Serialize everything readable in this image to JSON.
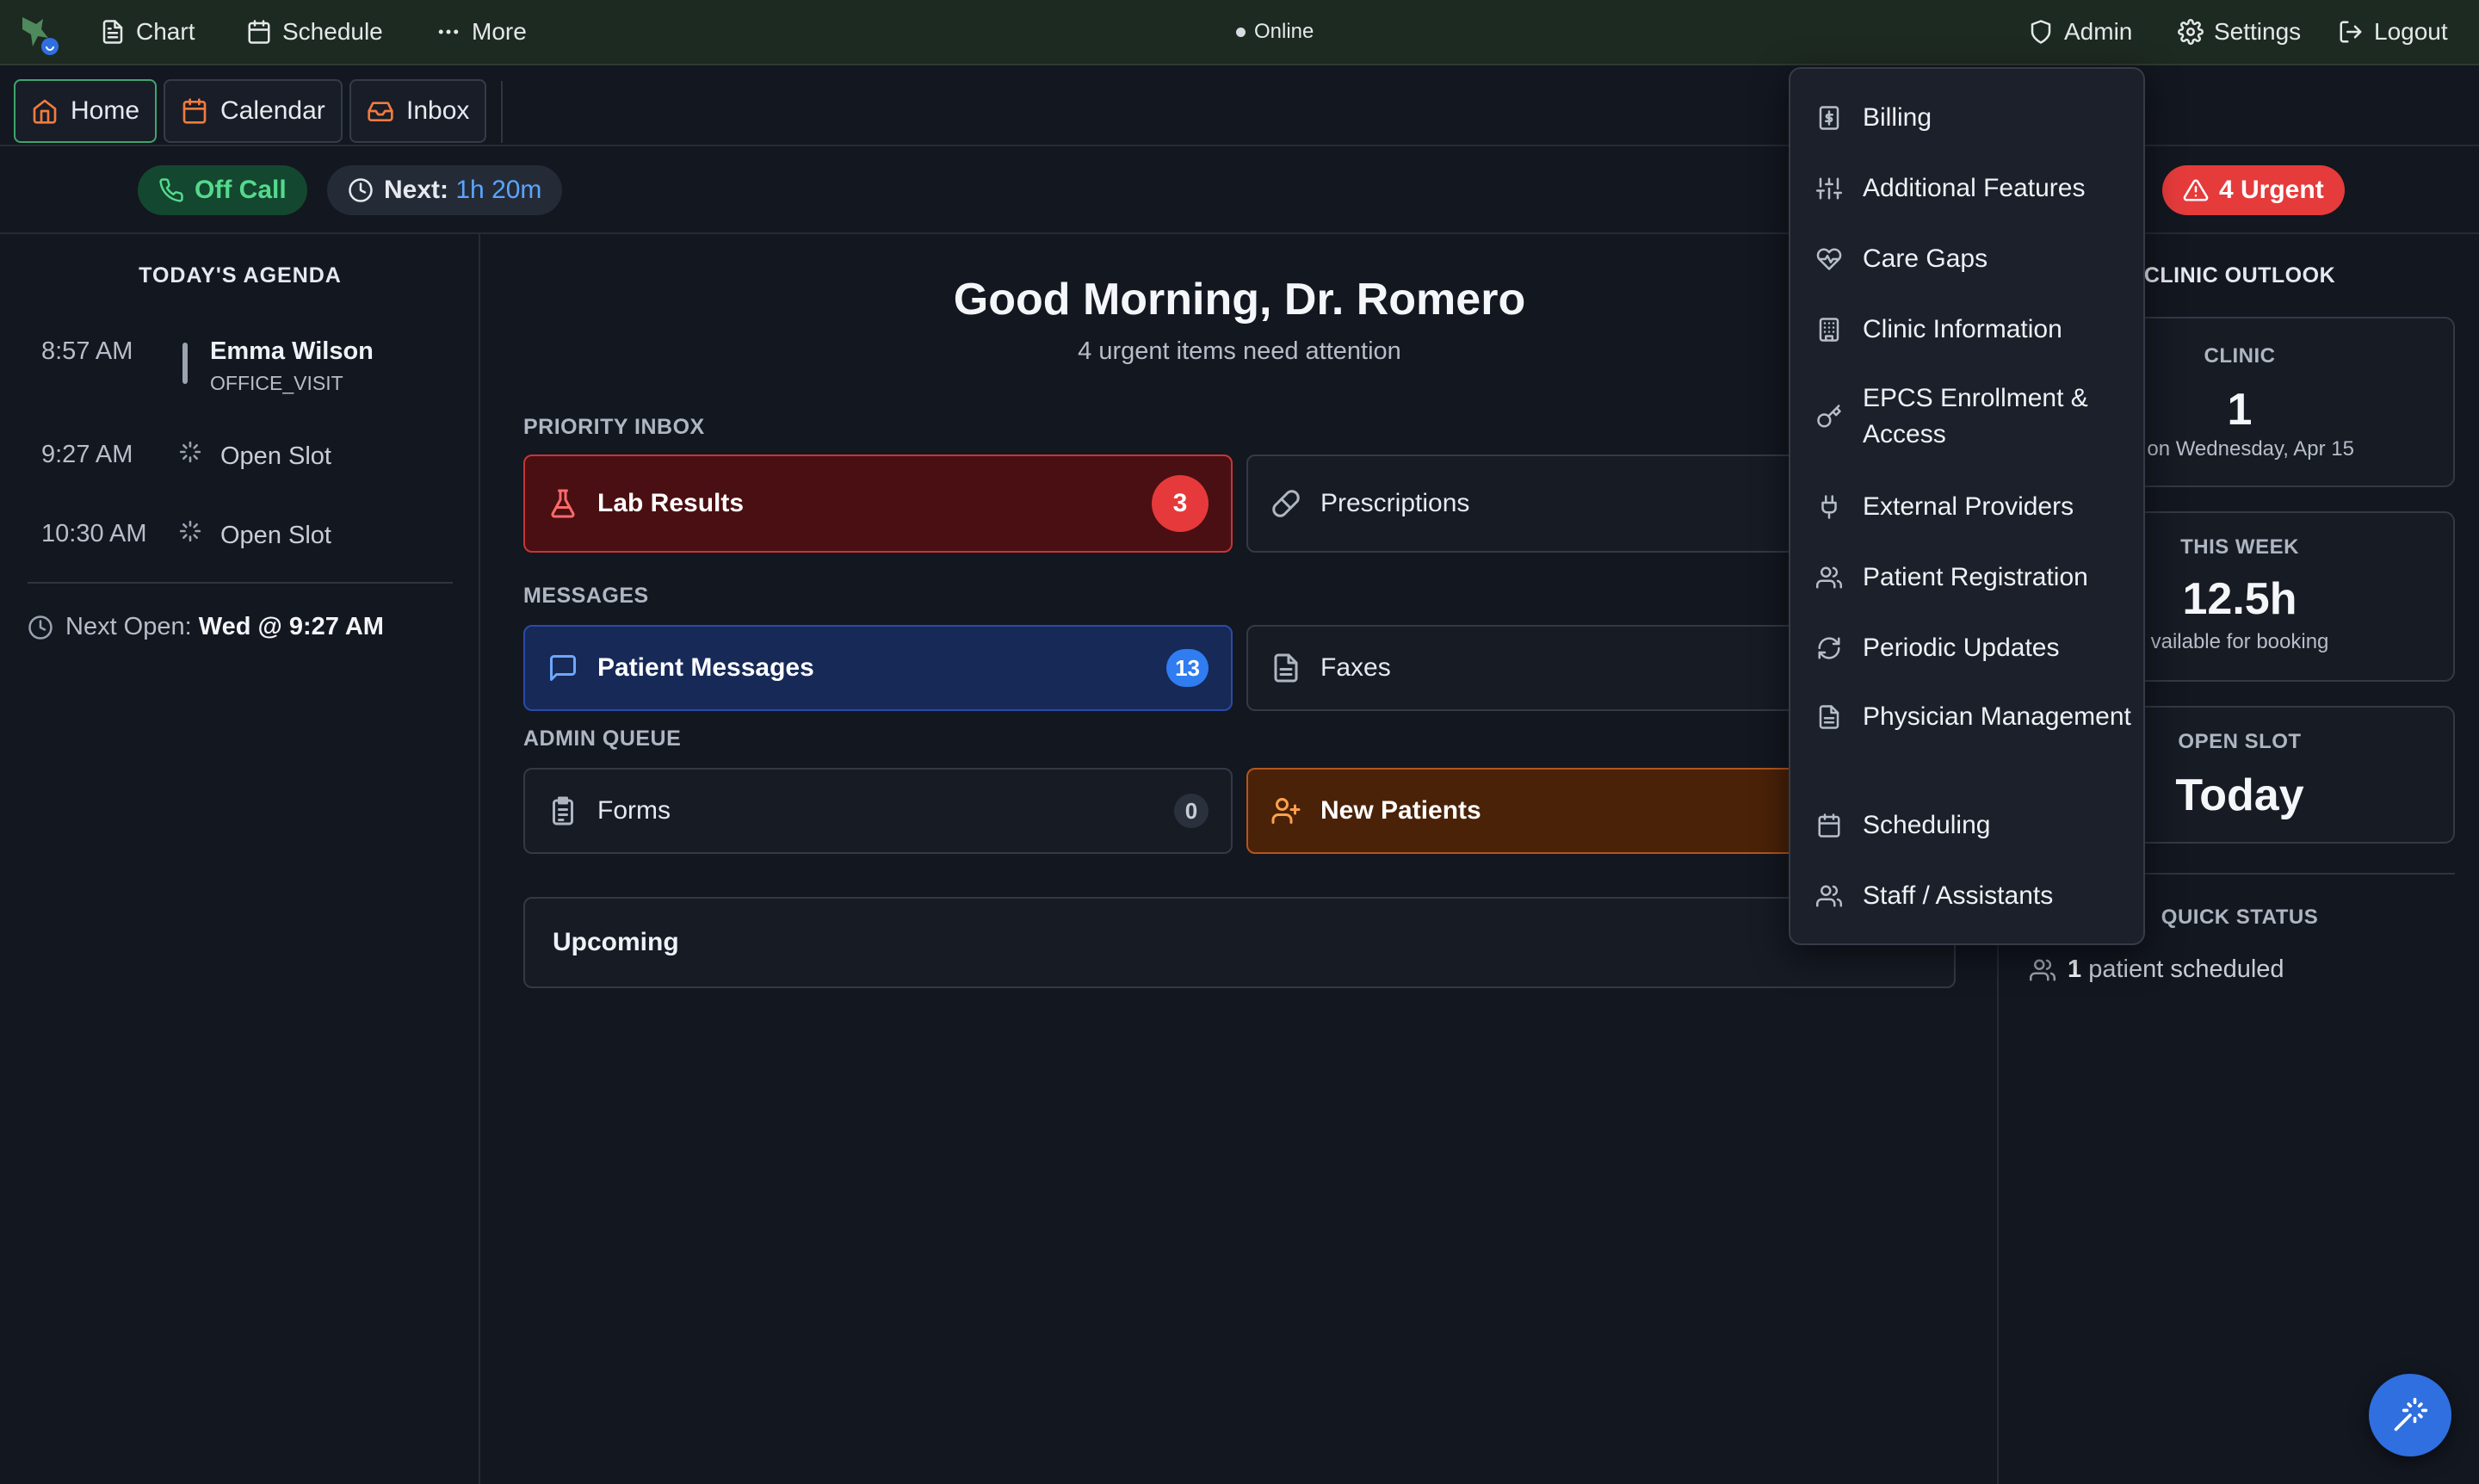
{
  "topbar": {
    "nav": [
      {
        "label": "Chart",
        "icon": "file-text-icon"
      },
      {
        "label": "Schedule",
        "icon": "calendar-icon"
      },
      {
        "label": "More",
        "icon": "ellipsis-icon"
      }
    ],
    "status": "Online",
    "admin_label": "Admin",
    "settings_label": "Settings",
    "logout_label": "Logout"
  },
  "tabs": [
    {
      "label": "Home",
      "icon": "home-icon",
      "active": true
    },
    {
      "label": "Calendar",
      "icon": "calendar-icon",
      "active": false
    },
    {
      "label": "Inbox",
      "icon": "inbox-icon",
      "active": false
    }
  ],
  "status_bar": {
    "call_status": "Off Call",
    "next_label": "Next:",
    "next_time": "1h 20m",
    "urgent_label": "4 Urgent"
  },
  "agenda": {
    "title": "TODAY'S AGENDA",
    "items": [
      {
        "time": "8:57 AM",
        "name": "Emma Wilson",
        "type": "OFFICE_VISIT"
      },
      {
        "time": "9:27 AM",
        "slot": "Open Slot"
      },
      {
        "time": "10:30 AM",
        "slot": "Open Slot"
      }
    ],
    "next_open_label": "Next Open:",
    "next_open_value": "Wed @ 9:27 AM"
  },
  "main": {
    "greeting": "Good Morning, Dr. Romero",
    "subtitle": "4 urgent items need attention",
    "priority_label": "PRIORITY INBOX",
    "messages_label": "MESSAGES",
    "admin_label": "ADMIN QUEUE",
    "cards": {
      "lab_results": {
        "label": "Lab Results",
        "count": "3"
      },
      "prescriptions": {
        "label": "Prescriptions"
      },
      "patient_messages": {
        "label": "Patient Messages",
        "count": "13"
      },
      "faxes": {
        "label": "Faxes"
      },
      "forms": {
        "label": "Forms",
        "count": "0"
      },
      "new_patients": {
        "label": "New Patients"
      }
    },
    "upcoming_label": "Upcoming"
  },
  "outlook": {
    "title": "CLINIC OUTLOOK",
    "cards": [
      {
        "label": "CLINIC",
        "value": "1",
        "sub": "ts on Wednesday, Apr 15"
      },
      {
        "label": "THIS WEEK",
        "value": "12.5h",
        "sub": "vailable for booking"
      },
      {
        "label": "OPEN SLOT",
        "value": "Today"
      }
    ],
    "quick_status_label": "QUICK STATUS",
    "quick_status_count": "1",
    "quick_status_text": "patient scheduled"
  },
  "admin_menu": {
    "items": [
      {
        "label": "Billing",
        "icon": "dollar-doc-icon"
      },
      {
        "label": "Additional Features",
        "icon": "sliders-icon"
      },
      {
        "label": "Care Gaps",
        "icon": "heart-pulse-icon"
      },
      {
        "label": "Clinic Information",
        "icon": "building-icon"
      },
      {
        "label": "EPCS Enrollment & Access",
        "icon": "key-icon"
      },
      {
        "label": "External Providers",
        "icon": "plug-icon"
      },
      {
        "label": "Patient Registration",
        "icon": "users-icon"
      },
      {
        "label": "Periodic Updates",
        "icon": "refresh-icon"
      },
      {
        "label": "Physician Management",
        "icon": "doc-icon"
      },
      {
        "label": "Scheduling",
        "icon": "calendar-icon"
      },
      {
        "label": "Staff / Assistants",
        "icon": "users-icon"
      }
    ]
  },
  "colors": {
    "topbar_bg": "#1d2a21",
    "page_bg": "#131720",
    "accent_green": "#55d98d",
    "accent_blue": "#5aa5ff",
    "urgent_red": "#e53b3b",
    "tab_icon_orange": "#f07b3f"
  }
}
